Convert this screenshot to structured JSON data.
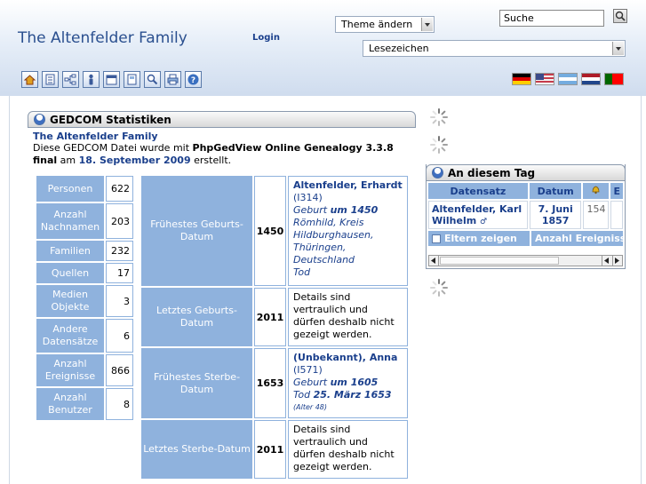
{
  "header": {
    "site_title": "The Altenfelder Family",
    "login_label": "Login",
    "theme_select": "Theme ändern",
    "bookmarks_select": "Lesezeichen",
    "search_value": "Suche"
  },
  "toolbar": {
    "icons": [
      "home-icon",
      "list-icon",
      "pedigree-icon",
      "person-icon",
      "calendar-icon",
      "report-icon",
      "search-icon",
      "print-icon",
      "help-icon"
    ]
  },
  "languages": [
    "Deutsch",
    "English",
    "Español",
    "Nederlands",
    "Português"
  ],
  "stats": {
    "block_title": "GEDCOM Statistiken",
    "family_title": "The Altenfelder Family",
    "desc_pre": "Diese GEDCOM Datei wurde mit ",
    "desc_software": "PhpGedView Online Genealogy 3.3.8 final",
    "desc_mid": " am ",
    "desc_date": "18. September 2009",
    "desc_post": " erstellt.",
    "counts": [
      {
        "label": "Personen",
        "value": "622"
      },
      {
        "label": "Anzahl Nachnamen",
        "value": "203"
      },
      {
        "label": "Familien",
        "value": "232"
      },
      {
        "label": "Quellen",
        "value": "17"
      },
      {
        "label": "Medien Objekte",
        "value": "3"
      },
      {
        "label": "Andere Datensätze",
        "value": "6"
      },
      {
        "label": "Anzahl Ereignisse",
        "value": "866"
      },
      {
        "label": "Anzahl Benutzer",
        "value": "8"
      }
    ],
    "dates": [
      {
        "label": "Frühestes Geburts-Datum",
        "year": "1450",
        "name": "Altenfelder, Erhardt",
        "id": "(I314)",
        "line1_pre": "Geburt",
        "line1_bold": "um 1450",
        "place": "Römhild, Kreis Hildburghausen, Thüringen, Deutschland",
        "line2": "Tod"
      },
      {
        "label": "Letztes Geburts-Datum",
        "year": "2011",
        "private": "Details sind vertraulich und dürfen deshalb nicht gezeigt werden."
      },
      {
        "label": "Frühestes Sterbe-Datum",
        "year": "1653",
        "name": "(Unbekannt), Anna",
        "id": "(I571)",
        "line1_pre": "Geburt",
        "line1_bold": "um 1605",
        "line2_pre": "Tod",
        "line2_bold": "25. März 1653",
        "age": "(Alter 48)"
      },
      {
        "label": "Letztes Sterbe-Datum",
        "year": "2011",
        "private": "Details sind vertraulich und dürfen deshalb nicht gezeigt werden."
      }
    ]
  },
  "today": {
    "block_title": "An diesem Tag",
    "col_record": "Datensatz",
    "col_date": "Datum",
    "col_e": "E",
    "row_name": "Altenfelder, Karl Wilhelm",
    "row_gender": "♂",
    "row_date": "7. Juni 1857",
    "row_num": "154",
    "footer_parents": "Eltern zeigen",
    "footer_count": "Anzahl Ereignisse"
  }
}
